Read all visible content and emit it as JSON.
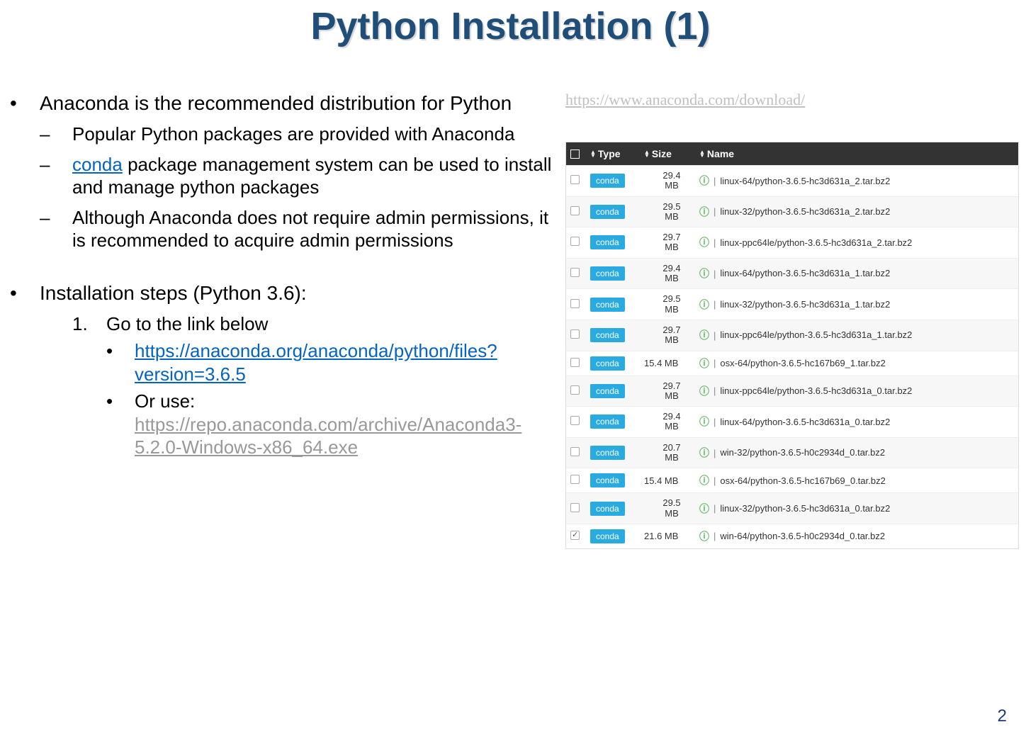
{
  "title": "Python Installation (1)",
  "left": {
    "b1_recommend": "Anaconda is the recommended distribution for Python",
    "s_pop": "Popular Python packages are provided with Anaconda",
    "s_conda_link": "conda",
    "s_conda_rest": " package management system can be used to install and manage python packages",
    "s_admin": "Although Anaconda does not require admin permissions, it is recommended to acquire admin permissions",
    "b1_install": "Installation steps (Python 3.6):",
    "step1": "Go to the link below",
    "step1_link": "https://anaconda.org/anaconda/python/files?version=3.6.5",
    "step1_or": "Or use:",
    "step1_or_link": "https://repo.anaconda.com/archive/Anaconda3-5.2.0-Windows-x86_64.exe"
  },
  "right": {
    "download_link": "https://www.anaconda.com/download/",
    "header": {
      "type": "Type",
      "size": "Size",
      "name": "Name"
    },
    "rows": [
      {
        "checked": false,
        "type": "conda",
        "size": "29.4 MB",
        "twoLine": true,
        "name": "linux-64/python-3.6.5-hc3d631a_2.tar.bz2"
      },
      {
        "checked": false,
        "type": "conda",
        "size": "29.5 MB",
        "twoLine": true,
        "name": "linux-32/python-3.6.5-hc3d631a_2.tar.bz2"
      },
      {
        "checked": false,
        "type": "conda",
        "size": "29.7 MB",
        "twoLine": true,
        "name": "linux-ppc64le/python-3.6.5-hc3d631a_2.tar.bz2"
      },
      {
        "checked": false,
        "type": "conda",
        "size": "29.4 MB",
        "twoLine": true,
        "name": "linux-64/python-3.6.5-hc3d631a_1.tar.bz2"
      },
      {
        "checked": false,
        "type": "conda",
        "size": "29.5 MB",
        "twoLine": true,
        "name": "linux-32/python-3.6.5-hc3d631a_1.tar.bz2"
      },
      {
        "checked": false,
        "type": "conda",
        "size": "29.7 MB",
        "twoLine": true,
        "name": "linux-ppc64le/python-3.6.5-hc3d631a_1.tar.bz2"
      },
      {
        "checked": false,
        "type": "conda",
        "size": "15.4 MB",
        "twoLine": false,
        "name": "osx-64/python-3.6.5-hc167b69_1.tar.bz2"
      },
      {
        "checked": false,
        "type": "conda",
        "size": "29.7 MB",
        "twoLine": true,
        "name": "linux-ppc64le/python-3.6.5-hc3d631a_0.tar.bz2"
      },
      {
        "checked": false,
        "type": "conda",
        "size": "29.4 MB",
        "twoLine": true,
        "name": "linux-64/python-3.6.5-hc3d631a_0.tar.bz2"
      },
      {
        "checked": false,
        "type": "conda",
        "size": "20.7 MB",
        "twoLine": true,
        "name": "win-32/python-3.6.5-h0c2934d_0.tar.bz2"
      },
      {
        "checked": false,
        "type": "conda",
        "size": "15.4 MB",
        "twoLine": false,
        "name": "osx-64/python-3.6.5-hc167b69_0.tar.bz2"
      },
      {
        "checked": false,
        "type": "conda",
        "size": "29.5 MB",
        "twoLine": true,
        "name": "linux-32/python-3.6.5-hc3d631a_0.tar.bz2"
      },
      {
        "checked": true,
        "type": "conda",
        "size": "21.6 MB",
        "twoLine": false,
        "name": "win-64/python-3.6.5-h0c2934d_0.tar.bz2"
      }
    ]
  },
  "pageNumber": "2"
}
